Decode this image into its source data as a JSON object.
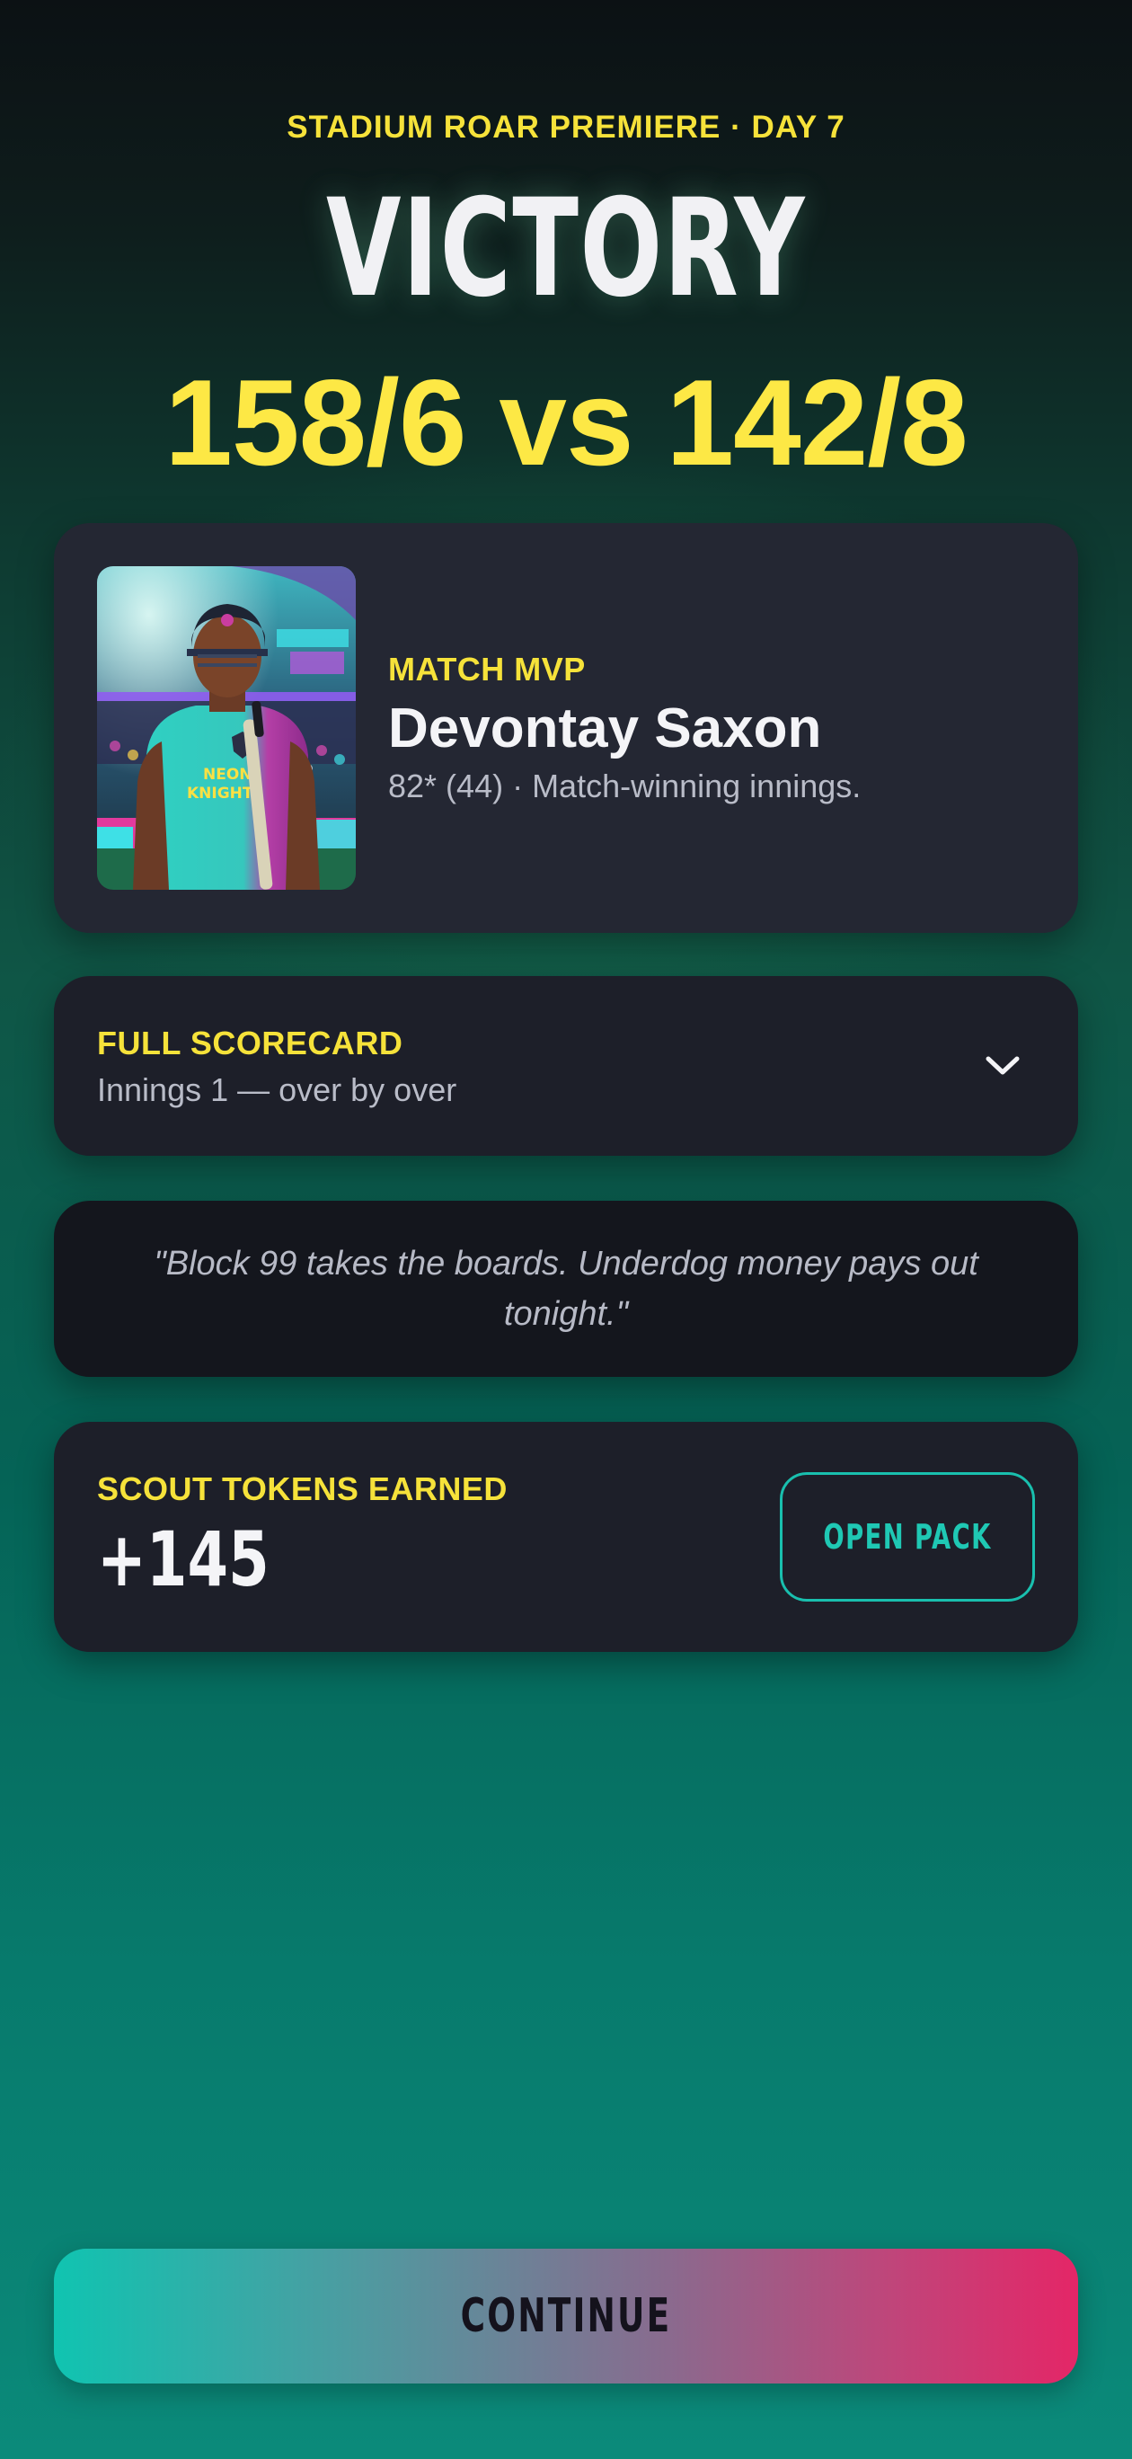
{
  "header": {
    "eyebrow": "STADIUM ROAR PREMIERE · DAY 7",
    "result": "VICTORY",
    "score": "158/6 vs 142/8"
  },
  "mvp": {
    "label": "MATCH MVP",
    "name": "Devontay Saxon",
    "summary": "82* (44) · Match-winning innings.",
    "jersey_text": "NEON KNIGHTS",
    "photo_icon": "player-portrait"
  },
  "scorecard": {
    "title": "FULL SCORECARD",
    "subtitle": "Innings 1 — over by over",
    "toggle_icon": "chevron-down-icon"
  },
  "quote": {
    "text": "\"Block 99 takes the boards. Underdog money pays out tonight.\""
  },
  "tokens": {
    "label": "SCOUT TOKENS EARNED",
    "value": "+145",
    "open_pack_label": "OPEN PACK"
  },
  "footer": {
    "continue_label": "CONTINUE"
  },
  "colors": {
    "accent_yellow": "#f6e23a",
    "score_yellow": "#fde845",
    "teal": "#19bfae",
    "pink": "#e42667",
    "card": "#1d1f29"
  }
}
